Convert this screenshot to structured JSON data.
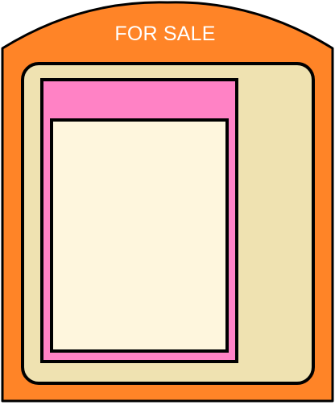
{
  "sign": {
    "title": "FOR SALE"
  },
  "colors": {
    "frame": "#FF8427",
    "board": "#EFE2B1",
    "listing_header": "#FF82C5",
    "listing_border": "#FF82C5",
    "listing_paper": "#FEF6DD",
    "outline": "#000000",
    "title_text": "#FFFFFF"
  }
}
